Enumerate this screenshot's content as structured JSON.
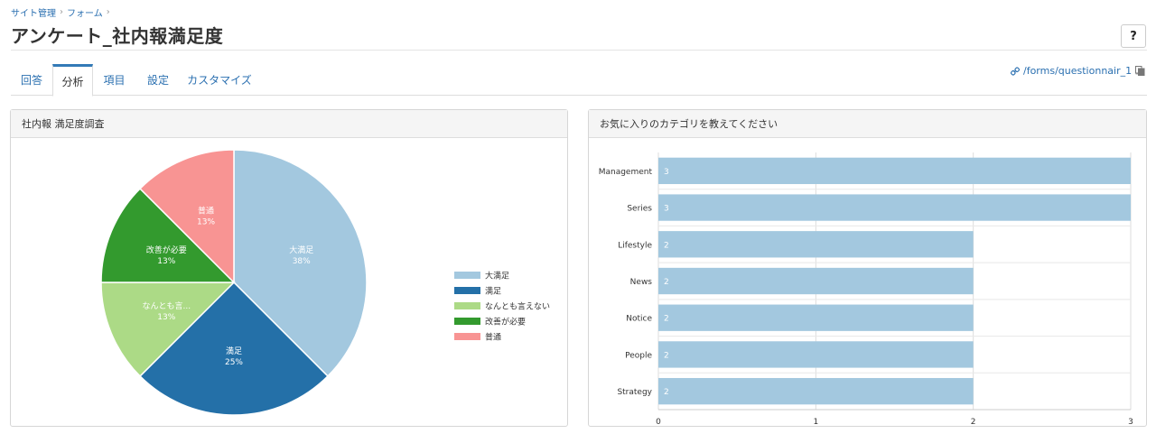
{
  "breadcrumb": {
    "site_admin": "サイト管理",
    "form": "フォーム",
    "sep": "›"
  },
  "page": {
    "title": "アンケート_社内報満足度",
    "help_label": "?"
  },
  "tabs": [
    {
      "label": "回答"
    },
    {
      "label": "分析",
      "active": true
    },
    {
      "label": "項目"
    },
    {
      "label": "設定"
    },
    {
      "label": "カスタマイズ"
    }
  ],
  "form_link": {
    "text": "/forms/questionnair_1",
    "link_icon": "link-icon",
    "external_icon": "external-link-icon",
    "copy_icon": "copy-icon"
  },
  "colors": {
    "link": "#2a6fb0",
    "tab_accent": "#337ab7"
  },
  "panels": {
    "pie_title": "社内報 満足度調査",
    "bar_title": "お気に入りのカテゴリを教えてください"
  },
  "chart_data": [
    {
      "type": "pie",
      "title": "社内報 満足度調査",
      "slices": [
        {
          "label": "大満足",
          "slice_label": "大満足",
          "pct_label": "38%",
          "value": 3,
          "color": "#a3c8df"
        },
        {
          "label": "満足",
          "slice_label": "満足",
          "pct_label": "25%",
          "value": 2,
          "color": "#2470a8"
        },
        {
          "label": "なんとも言えない",
          "slice_label": "なんとも言...",
          "pct_label": "13%",
          "value": 1,
          "color": "#acda86"
        },
        {
          "label": "改善が必要",
          "slice_label": "改善が必要",
          "pct_label": "13%",
          "value": 1,
          "color": "#339a2e"
        },
        {
          "label": "普通",
          "slice_label": "普通",
          "pct_label": "13%",
          "value": 1,
          "color": "#f89493"
        }
      ],
      "legend_position": "right"
    },
    {
      "type": "bar",
      "orientation": "horizontal",
      "title": "お気に入りのカテゴリを教えてください",
      "categories": [
        "Management",
        "Series",
        "Lifestyle",
        "News",
        "Notice",
        "People",
        "Strategy"
      ],
      "values": [
        3,
        3,
        2,
        2,
        2,
        2,
        2
      ],
      "value_labels": [
        "3",
        "3",
        "2",
        "2",
        "2",
        "2",
        "2"
      ],
      "xlim": [
        0,
        3
      ],
      "xticks": [
        "0",
        "1",
        "2",
        "3"
      ],
      "bar_color": "#a3c8df",
      "grid": true
    }
  ]
}
